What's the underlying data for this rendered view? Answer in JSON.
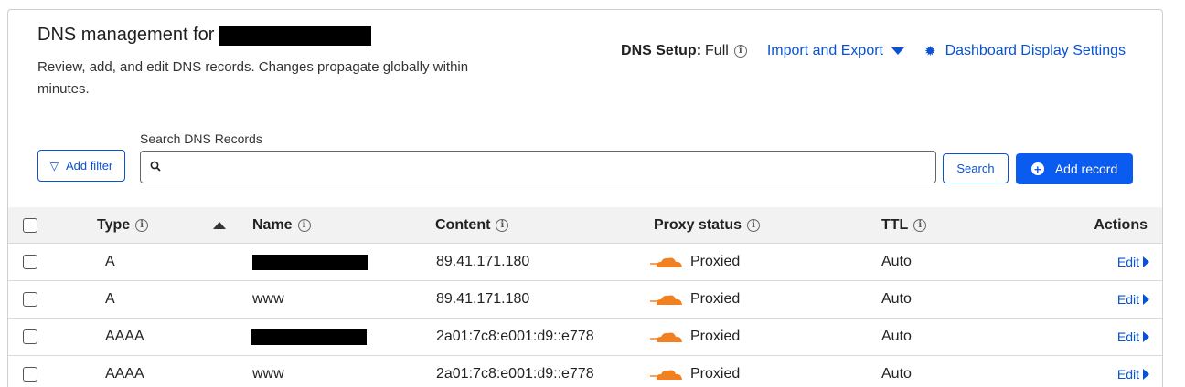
{
  "header": {
    "title_prefix": "DNS management for",
    "subtitle": "Review, add, and edit DNS records. Changes propagate globally within minutes.",
    "setup_label": "DNS Setup:",
    "setup_value": "Full",
    "import_export": "Import and Export",
    "dashboard_settings": "Dashboard Display Settings"
  },
  "toolbar": {
    "add_filter": "Add filter",
    "search_label": "Search DNS Records",
    "search_value": "",
    "search_placeholder": "",
    "search_button": "Search",
    "add_record": "Add record"
  },
  "table": {
    "columns": {
      "type": "Type",
      "name": "Name",
      "content": "Content",
      "proxy": "Proxy status",
      "ttl": "TTL",
      "actions": "Actions"
    },
    "rows": [
      {
        "type": "A",
        "name": "",
        "content": "89.41.171.180",
        "proxy": "Proxied",
        "ttl": "Auto",
        "edit": "Edit"
      },
      {
        "type": "A",
        "name": "www",
        "content": "89.41.171.180",
        "proxy": "Proxied",
        "ttl": "Auto",
        "edit": "Edit"
      },
      {
        "type": "AAAA",
        "name": "",
        "content": "2a01:7c8:e001:d9::e778",
        "proxy": "Proxied",
        "ttl": "Auto",
        "edit": "Edit"
      },
      {
        "type": "AAAA",
        "name": "www",
        "content": "2a01:7c8:e001:d9::e778",
        "proxy": "Proxied",
        "ttl": "Auto",
        "edit": "Edit"
      }
    ]
  },
  "icons": {
    "info": "info-icon",
    "gear": "gear-icon",
    "filter": "filter-icon",
    "search": "search-icon",
    "plus": "plus-circle-icon",
    "cloud": "orange-cloud-icon"
  },
  "colors": {
    "accent": "#0a52d1",
    "primary_button": "#0a5cf0",
    "cloud": "#f38020"
  }
}
